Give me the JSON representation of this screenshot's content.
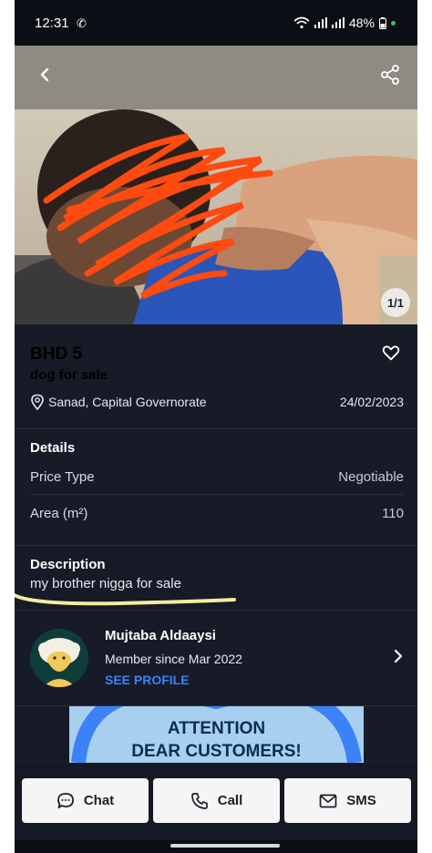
{
  "status_bar": {
    "time": "12:31",
    "battery": "48%"
  },
  "photo": {
    "counter": "1/1"
  },
  "listing": {
    "price": "BHD 5",
    "title": "dog for sale",
    "location": "Sanad, Capital Governorate",
    "date": "24/02/2023"
  },
  "details": {
    "heading": "Details",
    "rows": [
      {
        "label": "Price Type",
        "value": "Negotiable"
      },
      {
        "label": "Area (m²)",
        "value": "110"
      }
    ]
  },
  "description": {
    "heading": "Description",
    "text": "my brother nigga for sale"
  },
  "seller": {
    "name": "Mujtaba Aldaaysi",
    "member_since": "Member since Mar 2022",
    "see_profile": "SEE PROFILE"
  },
  "banner": {
    "line1": "ATTENTION",
    "line2": "DEAR CUSTOMERS!"
  },
  "actions": {
    "chat": "Chat",
    "call": "Call",
    "sms": "SMS"
  },
  "icons": {
    "back": "back-arrow-icon",
    "share": "share-icon",
    "favorite": "heart-icon",
    "location": "location-pin-icon",
    "chevron": "chevron-right-icon",
    "chat": "chat-bubble-icon",
    "call": "phone-icon",
    "sms": "envelope-icon"
  },
  "colors": {
    "background": "#161b27",
    "link": "#3b82f6",
    "scribble": "#ff4a10",
    "underline": "#f2eea0"
  }
}
